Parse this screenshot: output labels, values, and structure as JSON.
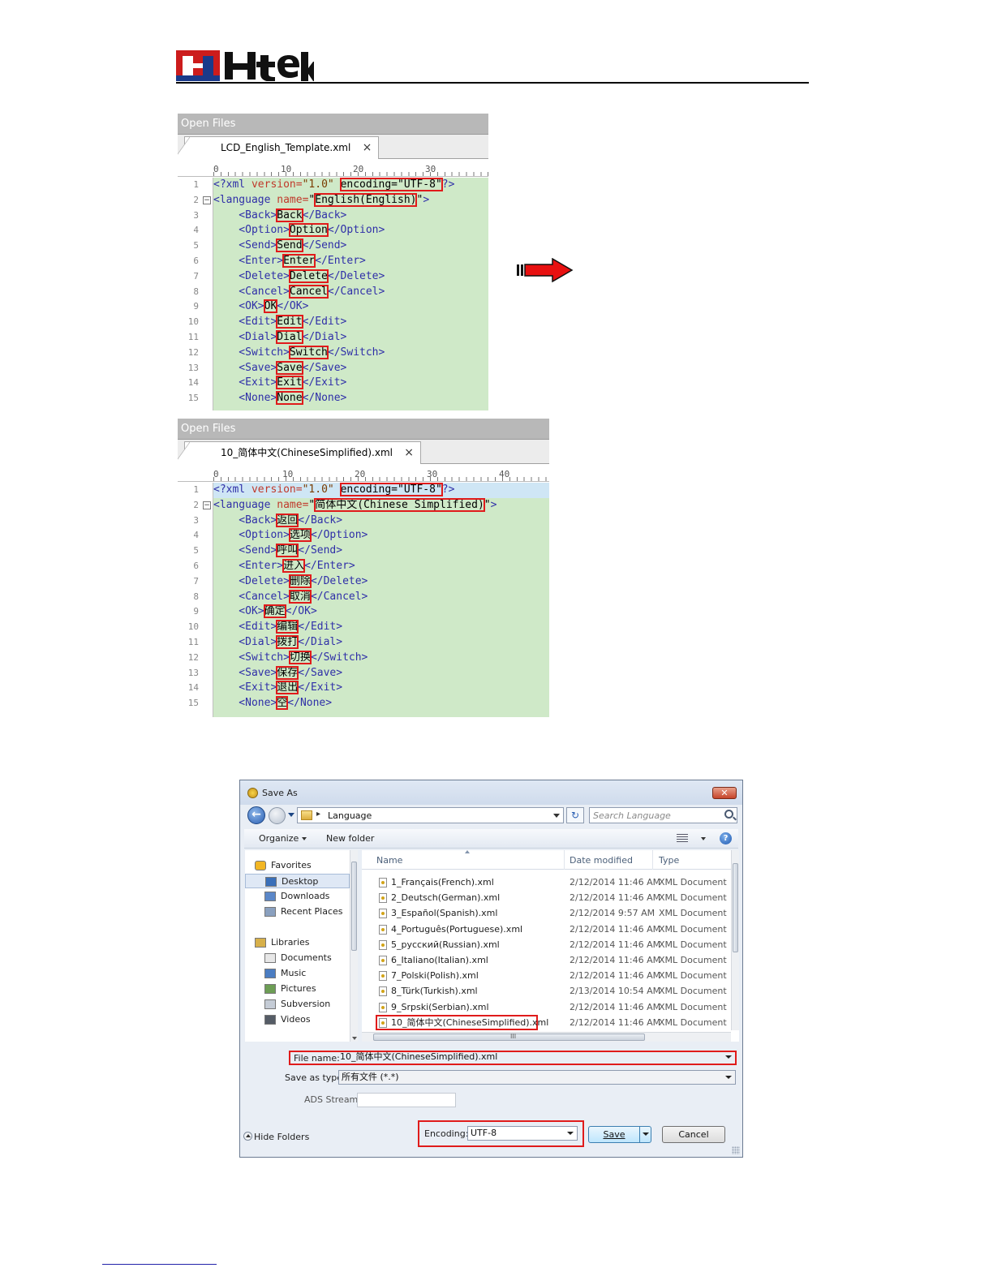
{
  "header": {
    "logo_alt": "Htek"
  },
  "editor1": {
    "panel_title": "Open Files",
    "tab_label": "LCD_English_Template.xml",
    "tab_close": "×",
    "ruler": [
      "0",
      "10",
      "20",
      "30"
    ],
    "lines": [
      {
        "n": "1",
        "parts": [
          {
            "c": "t",
            "s": "<?xml "
          },
          {
            "c": "a",
            "s": "version="
          },
          {
            "c": "v",
            "s": "\"1.0\" "
          },
          {
            "c": "box",
            "s": "encoding=\"UTF-8\""
          },
          {
            "c": "t",
            "s": "?>"
          }
        ]
      },
      {
        "n": "2",
        "fold": "−",
        "parts": [
          {
            "c": "t",
            "s": "<language "
          },
          {
            "c": "a",
            "s": "name="
          },
          {
            "c": "txt",
            "s": "\""
          },
          {
            "c": "box",
            "s": "English(English)"
          },
          {
            "c": "txt",
            "s": "\""
          },
          {
            "c": "t",
            "s": ">"
          }
        ]
      },
      {
        "n": "3",
        "parts": [
          {
            "c": "t",
            "s": "    <Back>"
          },
          {
            "c": "box",
            "s": "Back"
          },
          {
            "c": "t",
            "s": "</Back>"
          }
        ]
      },
      {
        "n": "4",
        "parts": [
          {
            "c": "t",
            "s": "    <Option>"
          },
          {
            "c": "box",
            "s": "Option"
          },
          {
            "c": "t",
            "s": "</Option>"
          }
        ]
      },
      {
        "n": "5",
        "parts": [
          {
            "c": "t",
            "s": "    <Send>"
          },
          {
            "c": "box",
            "s": "Send"
          },
          {
            "c": "t",
            "s": "</Send>"
          }
        ]
      },
      {
        "n": "6",
        "parts": [
          {
            "c": "t",
            "s": "    <Enter>"
          },
          {
            "c": "box",
            "s": "Enter"
          },
          {
            "c": "t",
            "s": "</Enter>"
          }
        ]
      },
      {
        "n": "7",
        "parts": [
          {
            "c": "t",
            "s": "    <Delete>"
          },
          {
            "c": "box",
            "s": "Delete"
          },
          {
            "c": "t",
            "s": "</Delete>"
          }
        ]
      },
      {
        "n": "8",
        "parts": [
          {
            "c": "t",
            "s": "    <Cancel>"
          },
          {
            "c": "box",
            "s": "Cancel"
          },
          {
            "c": "t",
            "s": "</Cancel>"
          }
        ]
      },
      {
        "n": "9",
        "parts": [
          {
            "c": "t",
            "s": "    <OK>"
          },
          {
            "c": "box",
            "s": "OK"
          },
          {
            "c": "t",
            "s": "</OK>"
          }
        ]
      },
      {
        "n": "10",
        "parts": [
          {
            "c": "t",
            "s": "    <Edit>"
          },
          {
            "c": "box",
            "s": "Edit"
          },
          {
            "c": "t",
            "s": "</Edit>"
          }
        ]
      },
      {
        "n": "11",
        "parts": [
          {
            "c": "t",
            "s": "    <Dial>"
          },
          {
            "c": "box",
            "s": "Dial"
          },
          {
            "c": "t",
            "s": "</Dial>"
          }
        ]
      },
      {
        "n": "12",
        "parts": [
          {
            "c": "t",
            "s": "    <Switch>"
          },
          {
            "c": "box",
            "s": "Switch"
          },
          {
            "c": "t",
            "s": "</Switch>"
          }
        ]
      },
      {
        "n": "13",
        "parts": [
          {
            "c": "t",
            "s": "    <Save>"
          },
          {
            "c": "box",
            "s": "Save"
          },
          {
            "c": "t",
            "s": "</Save>"
          }
        ]
      },
      {
        "n": "14",
        "parts": [
          {
            "c": "t",
            "s": "    <Exit>"
          },
          {
            "c": "box",
            "s": "Exit"
          },
          {
            "c": "t",
            "s": "</Exit>"
          }
        ]
      },
      {
        "n": "15",
        "parts": [
          {
            "c": "t",
            "s": "    <None>"
          },
          {
            "c": "box",
            "s": "None"
          },
          {
            "c": "t",
            "s": "</None>"
          }
        ]
      }
    ]
  },
  "editor2": {
    "panel_title": "Open Files",
    "tab_label": "10_简体中文(ChineseSimplified).xml",
    "tab_close": "×",
    "ruler": [
      "0",
      "10",
      "20",
      "30",
      "40"
    ],
    "lines": [
      {
        "n": "1",
        "hl": true,
        "parts": [
          {
            "c": "t",
            "s": "<?xml "
          },
          {
            "c": "a",
            "s": "version="
          },
          {
            "c": "v",
            "s": "\"1.0\" "
          },
          {
            "c": "box",
            "s": "encoding=\"UTF-8\""
          },
          {
            "c": "t",
            "s": "?>"
          }
        ]
      },
      {
        "n": "2",
        "fold": "−",
        "parts": [
          {
            "c": "t",
            "s": "<language "
          },
          {
            "c": "a",
            "s": "name="
          },
          {
            "c": "txt",
            "s": "\""
          },
          {
            "c": "box",
            "s": "简体中文(Chinese Simplified)"
          },
          {
            "c": "txt",
            "s": "\""
          },
          {
            "c": "t",
            "s": ">"
          }
        ]
      },
      {
        "n": "3",
        "parts": [
          {
            "c": "t",
            "s": "    <Back>"
          },
          {
            "c": "box",
            "s": "返回"
          },
          {
            "c": "t",
            "s": "</Back>"
          }
        ]
      },
      {
        "n": "4",
        "parts": [
          {
            "c": "t",
            "s": "    <Option>"
          },
          {
            "c": "box",
            "s": "选项"
          },
          {
            "c": "t",
            "s": "</Option>"
          }
        ]
      },
      {
        "n": "5",
        "parts": [
          {
            "c": "t",
            "s": "    <Send>"
          },
          {
            "c": "box",
            "s": "呼叫"
          },
          {
            "c": "t",
            "s": "</Send>"
          }
        ]
      },
      {
        "n": "6",
        "parts": [
          {
            "c": "t",
            "s": "    <Enter>"
          },
          {
            "c": "box",
            "s": "进入"
          },
          {
            "c": "t",
            "s": "</Enter>"
          }
        ]
      },
      {
        "n": "7",
        "parts": [
          {
            "c": "t",
            "s": "    <Delete>"
          },
          {
            "c": "box",
            "s": "删除"
          },
          {
            "c": "t",
            "s": "</Delete>"
          }
        ]
      },
      {
        "n": "8",
        "parts": [
          {
            "c": "t",
            "s": "    <Cancel>"
          },
          {
            "c": "box",
            "s": "取消"
          },
          {
            "c": "t",
            "s": "</Cancel>"
          }
        ]
      },
      {
        "n": "9",
        "parts": [
          {
            "c": "t",
            "s": "    <OK>"
          },
          {
            "c": "box",
            "s": "确定"
          },
          {
            "c": "t",
            "s": "</OK>"
          }
        ]
      },
      {
        "n": "10",
        "parts": [
          {
            "c": "t",
            "s": "    <Edit>"
          },
          {
            "c": "box",
            "s": "编辑"
          },
          {
            "c": "t",
            "s": "</Edit>"
          }
        ]
      },
      {
        "n": "11",
        "parts": [
          {
            "c": "t",
            "s": "    <Dial>"
          },
          {
            "c": "box",
            "s": "拨打"
          },
          {
            "c": "t",
            "s": "</Dial>"
          }
        ]
      },
      {
        "n": "12",
        "parts": [
          {
            "c": "t",
            "s": "    <Switch>"
          },
          {
            "c": "box",
            "s": "切换"
          },
          {
            "c": "t",
            "s": "</Switch>"
          }
        ]
      },
      {
        "n": "13",
        "parts": [
          {
            "c": "t",
            "s": "    <Save>"
          },
          {
            "c": "box",
            "s": "保存"
          },
          {
            "c": "t",
            "s": "</Save>"
          }
        ]
      },
      {
        "n": "14",
        "parts": [
          {
            "c": "t",
            "s": "    <Exit>"
          },
          {
            "c": "box",
            "s": "退出"
          },
          {
            "c": "t",
            "s": "</Exit>"
          }
        ]
      },
      {
        "n": "15",
        "parts": [
          {
            "c": "t",
            "s": "    <None>"
          },
          {
            "c": "box",
            "s": "空"
          },
          {
            "c": "t",
            "s": "</None>"
          }
        ]
      }
    ]
  },
  "dialog": {
    "title": "Save As",
    "close": "✕",
    "back": "←",
    "refresh": "↻",
    "address": "Language",
    "address_sep": "▸",
    "search_placeholder": "Search Language",
    "help": "?",
    "toolbar": {
      "organize": "Organize",
      "new_folder": "New folder"
    },
    "nav": [
      {
        "label": "Favorites",
        "icon": "star-icon",
        "indent": 0
      },
      {
        "label": "Desktop",
        "icon": "desktop-icon",
        "indent": 1,
        "selected": true
      },
      {
        "label": "Downloads",
        "icon": "downloads-icon",
        "indent": 1
      },
      {
        "label": "Recent Places",
        "icon": "recent-places-icon",
        "indent": 1
      },
      {
        "label": "Libraries",
        "icon": "libraries-icon",
        "indent": 0,
        "gap": true
      },
      {
        "label": "Documents",
        "icon": "documents-icon",
        "indent": 1
      },
      {
        "label": "Music",
        "icon": "music-icon",
        "indent": 1
      },
      {
        "label": "Pictures",
        "icon": "pictures-icon",
        "indent": 1
      },
      {
        "label": "Subversion",
        "icon": "subversion-icon",
        "indent": 1
      },
      {
        "label": "Videos",
        "icon": "videos-icon",
        "indent": 1
      }
    ],
    "columns": {
      "name": "Name",
      "date": "Date modified",
      "type": "Type"
    },
    "files": [
      {
        "name": "1_Français(French).xml",
        "date": "2/12/2014 11:46 AM",
        "type": "XML Document"
      },
      {
        "name": "2_Deutsch(German).xml",
        "date": "2/12/2014 11:46 AM",
        "type": "XML Document"
      },
      {
        "name": "3_Español(Spanish).xml",
        "date": "2/12/2014 9:57 AM",
        "type": "XML Document"
      },
      {
        "name": "4_Português(Portuguese).xml",
        "date": "2/12/2014 11:46 AM",
        "type": "XML Document"
      },
      {
        "name": "5_русский(Russian).xml",
        "date": "2/12/2014 11:46 AM",
        "type": "XML Document"
      },
      {
        "name": "6_Italiano(Italian).xml",
        "date": "2/12/2014 11:46 AM",
        "type": "XML Document"
      },
      {
        "name": "7_Polski(Polish).xml",
        "date": "2/12/2014 11:46 AM",
        "type": "XML Document"
      },
      {
        "name": "8_Türk(Turkish).xml",
        "date": "2/13/2014 10:54 AM",
        "type": "XML Document"
      },
      {
        "name": "9_Srpski(Serbian).xml",
        "date": "2/12/2014 11:46 AM",
        "type": "XML Document"
      },
      {
        "name": "10_简体中文(ChineseSimplified).xml",
        "date": "2/12/2014 11:46 AM",
        "type": "XML Document",
        "marked": true
      }
    ],
    "hscroll_grip": "III",
    "file_name_label": "File name:",
    "file_name_value": "10_简体中文(ChineseSimplified).xml",
    "save_type_label": "Save as type:",
    "save_type_value": "所有文件 (*.*)",
    "ads_label": "ADS Stream:",
    "ads_value": "",
    "hide_folders": "Hide Folders",
    "encoding_label": "Encoding:",
    "encoding_value": "UTF-8",
    "save_button": "Save",
    "cancel_button": "Cancel"
  },
  "colors": {
    "highlight_red": "#e01b1b",
    "editor_bg": "#cfe9c8",
    "tag_blue": "#2f2fa8",
    "attr_red": "#c0392b"
  }
}
